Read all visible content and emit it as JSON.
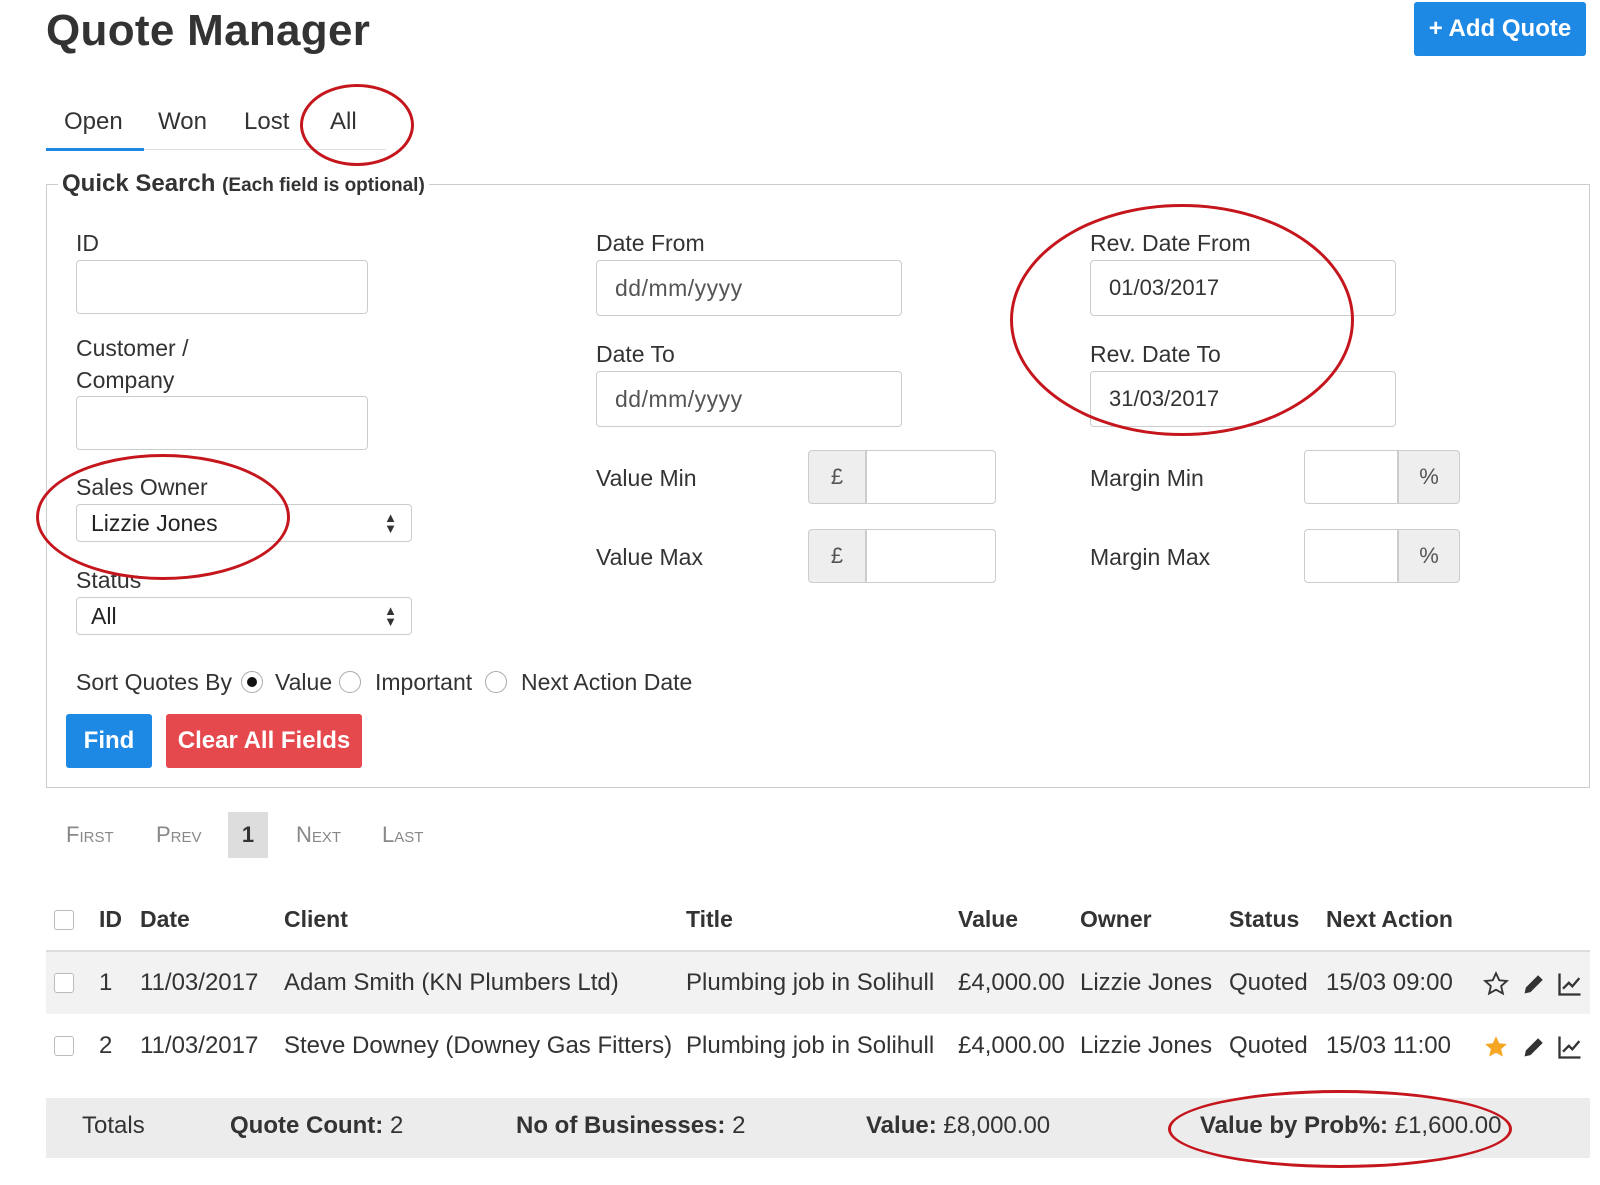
{
  "header": {
    "title": "Quote Manager",
    "add_button": "+ Add Quote"
  },
  "tabs": [
    {
      "label": "Open",
      "active": true
    },
    {
      "label": "Won",
      "active": false
    },
    {
      "label": "Lost",
      "active": false
    },
    {
      "label": "All",
      "active": false
    }
  ],
  "search": {
    "legend": "Quick Search",
    "legend_note": "(Each field is optional)",
    "id_label": "ID",
    "id_value": "",
    "customer_label_1": "Customer /",
    "customer_label_2": "Company",
    "customer_value": "",
    "sales_owner_label": "Sales Owner",
    "sales_owner_value": "Lizzie Jones",
    "status_label": "Status",
    "status_value": "All",
    "date_from_label": "Date From",
    "date_from_placeholder": "dd/mm/yyyy",
    "date_to_label": "Date To",
    "date_to_placeholder": "dd/mm/yyyy",
    "value_min_label": "Value Min",
    "value_max_label": "Value Max",
    "currency_symbol": "£",
    "rev_date_from_label": "Rev. Date From",
    "rev_date_from_value": "01/03/2017",
    "rev_date_to_label": "Rev. Date To",
    "rev_date_to_value": "31/03/2017",
    "margin_min_label": "Margin Min",
    "margin_max_label": "Margin Max",
    "percent_symbol": "%",
    "sort_label": "Sort Quotes By",
    "sort_options": [
      "Value",
      "Important",
      "Next Action Date"
    ],
    "sort_selected": "Value",
    "find_button": "Find",
    "clear_button": "Clear All Fields"
  },
  "pagination": {
    "first": "First",
    "prev": "Prev",
    "current": "1",
    "next": "Next",
    "last": "Last"
  },
  "table": {
    "columns": [
      "ID",
      "Date",
      "Client",
      "Title",
      "Value",
      "Owner",
      "Status",
      "Next Action"
    ],
    "rows": [
      {
        "id": "1",
        "date": "11/03/2017",
        "client": "Adam Smith (KN Plumbers Ltd)",
        "title": "Plumbing job in Solihull",
        "value": "£4,000.00",
        "owner": "Lizzie Jones",
        "status": "Quoted",
        "next_action": "15/03 09:00",
        "starred": false
      },
      {
        "id": "2",
        "date": "11/03/2017",
        "client": "Steve Downey (Downey Gas Fitters)",
        "title": "Plumbing job in Solihull",
        "value": "£4,000.00",
        "owner": "Lizzie Jones",
        "status": "Quoted",
        "next_action": "15/03 11:00",
        "starred": true
      }
    ]
  },
  "totals": {
    "label": "Totals",
    "quote_count_label": "Quote Count:",
    "quote_count": "2",
    "businesses_label": "No of Businesses:",
    "businesses": "2",
    "value_label": "Value:",
    "value": "£8,000.00",
    "prob_label": "Value by Prob%:",
    "prob_value": "£1,600.00"
  },
  "colors": {
    "primary": "#1e88e5",
    "danger": "#e5484d",
    "annotation": "#c4161c",
    "star": "#f5a623"
  },
  "icons": [
    "star-icon",
    "pencil-icon",
    "chart-icon"
  ]
}
